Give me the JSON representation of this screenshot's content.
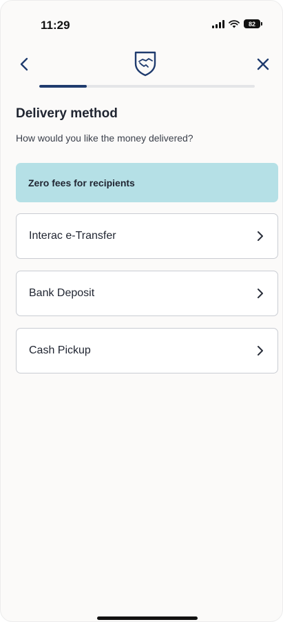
{
  "status_bar": {
    "time": "11:29",
    "battery": "82"
  },
  "nav": {
    "back_icon": "chevron-left-icon",
    "logo_icon": "shield-handshake-icon",
    "close_icon": "close-icon"
  },
  "progress": {
    "fraction": 0.22,
    "fill_color": "#1f3b6e"
  },
  "page": {
    "title": "Delivery method",
    "subtitle": "How would you like the money delivered?"
  },
  "banner": {
    "text": "Zero fees for recipients",
    "color": "#b5e0e6"
  },
  "options": [
    {
      "label": "Interac e-Transfer"
    },
    {
      "label": "Bank Deposit"
    },
    {
      "label": "Cash Pickup"
    }
  ]
}
